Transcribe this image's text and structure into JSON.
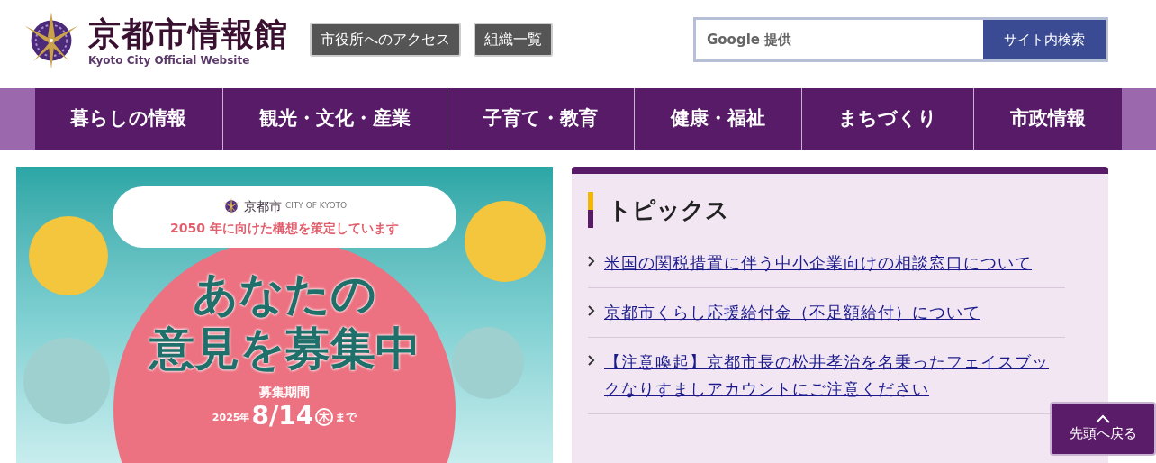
{
  "header": {
    "site_title": "京都市情報館",
    "site_subtitle": "Kyoto City Official Website",
    "buttons": [
      "市役所へのアクセス",
      "組織一覧"
    ],
    "search": {
      "placeholder": "Google 提供",
      "button": "サイト内検索"
    }
  },
  "nav": [
    {
      "label": "暮らしの情報"
    },
    {
      "label": "観光・文化・産業"
    },
    {
      "label": "子育て・教育"
    },
    {
      "label": "健康・福祉"
    },
    {
      "label": "まちづくり"
    },
    {
      "label": "市政情報"
    }
  ],
  "banner": {
    "logo_text": "京都市",
    "logo_sub": "CITY OF KYOTO",
    "tagline": "2050 年に向けた構想を策定しています",
    "headline_1": "あなたの",
    "headline_2": "意見を募集中",
    "period_label": "募集期間",
    "year": "2025年",
    "date": "8/14",
    "weekday": "木",
    "until": "まで"
  },
  "topics": {
    "title": "トピックス",
    "items": [
      {
        "text": "米国の関税措置に伴う中小企業向けの相談窓口について"
      },
      {
        "text": "京都市くらし応援給付金（不足額給付）について"
      },
      {
        "text": "【注意喚起】京都市長の松井孝治を名乗ったフェイスブックなりすましアカウントにご注意ください"
      }
    ]
  },
  "back_to_top": {
    "label": "先頭へ戻る"
  }
}
